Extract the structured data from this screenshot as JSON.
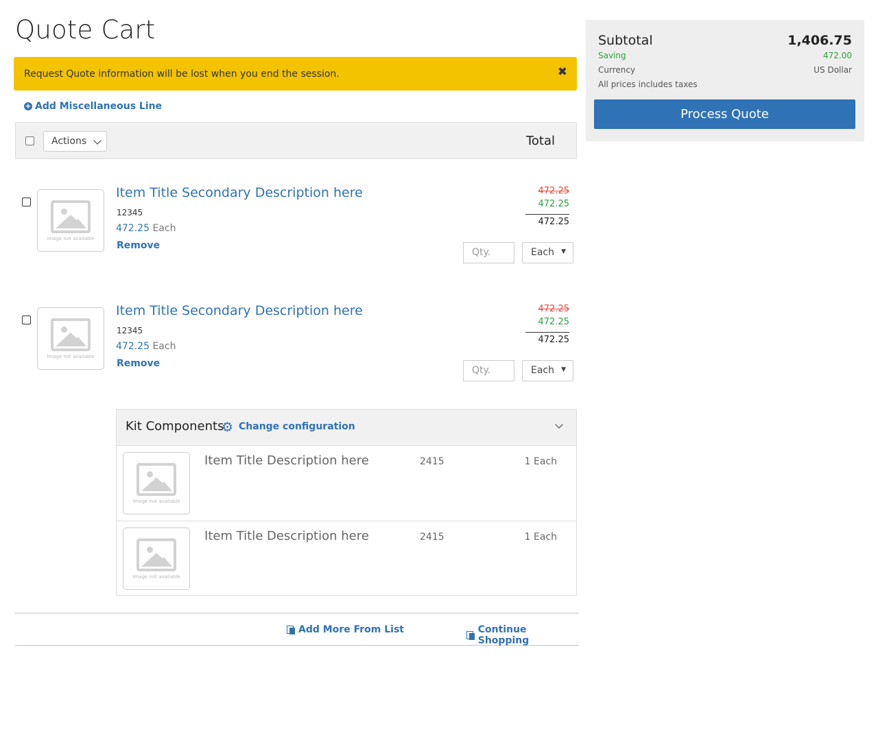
{
  "page": {
    "title": "Quote Cart"
  },
  "alert": {
    "message": "Request Quote information will be lost when you end the session.",
    "close_glyph": "✖"
  },
  "add_misc": {
    "label": "Add Miscellaneous Line"
  },
  "cart_header": {
    "actions_label": "Actions",
    "total_label": "Total"
  },
  "items": [
    {
      "title": "Item Title Secondary Description here",
      "sku": "12345",
      "unit_price": "472.25",
      "unit_label": "Each",
      "remove_label": "Remove",
      "original_price": "472.25",
      "sale_price": "472.25",
      "final_price": "472.25",
      "qty_placeholder": "Qty.",
      "uom": "Each",
      "image_alt": "Image not available"
    },
    {
      "title": "Item Title Secondary Description here",
      "sku": "12345",
      "unit_price": "472.25",
      "unit_label": "Each",
      "remove_label": "Remove",
      "original_price": "472.25",
      "sale_price": "472.25",
      "final_price": "472.25",
      "qty_placeholder": "Qty.",
      "uom": "Each",
      "image_alt": "Image not available"
    }
  ],
  "kit": {
    "title": "Kit Components",
    "change_label": "Change configuration",
    "components": [
      {
        "name": "Item Title Description here",
        "sku": "2415",
        "qty": "1 Each",
        "image_alt": "Image not available"
      },
      {
        "name": "Item Title Description here",
        "sku": "2415",
        "qty": "1 Each",
        "image_alt": "Image not available"
      }
    ]
  },
  "footer": {
    "add_more_label": "Add More From List",
    "continue_label": "Continue Shopping"
  },
  "summary": {
    "subtotal_label": "Subtotal",
    "subtotal_value": "1,406.75",
    "saving_label": "Saving",
    "saving_value": "472.00",
    "currency_label": "Currency",
    "currency_value": "US Dollar",
    "tax_note": "All prices includes taxes",
    "process_label": "Process Quote"
  },
  "colors": {
    "accent": "#2f72b5",
    "alert": "#f3c300",
    "sale": "#2e9e3d",
    "strike": "#e24a3b"
  }
}
